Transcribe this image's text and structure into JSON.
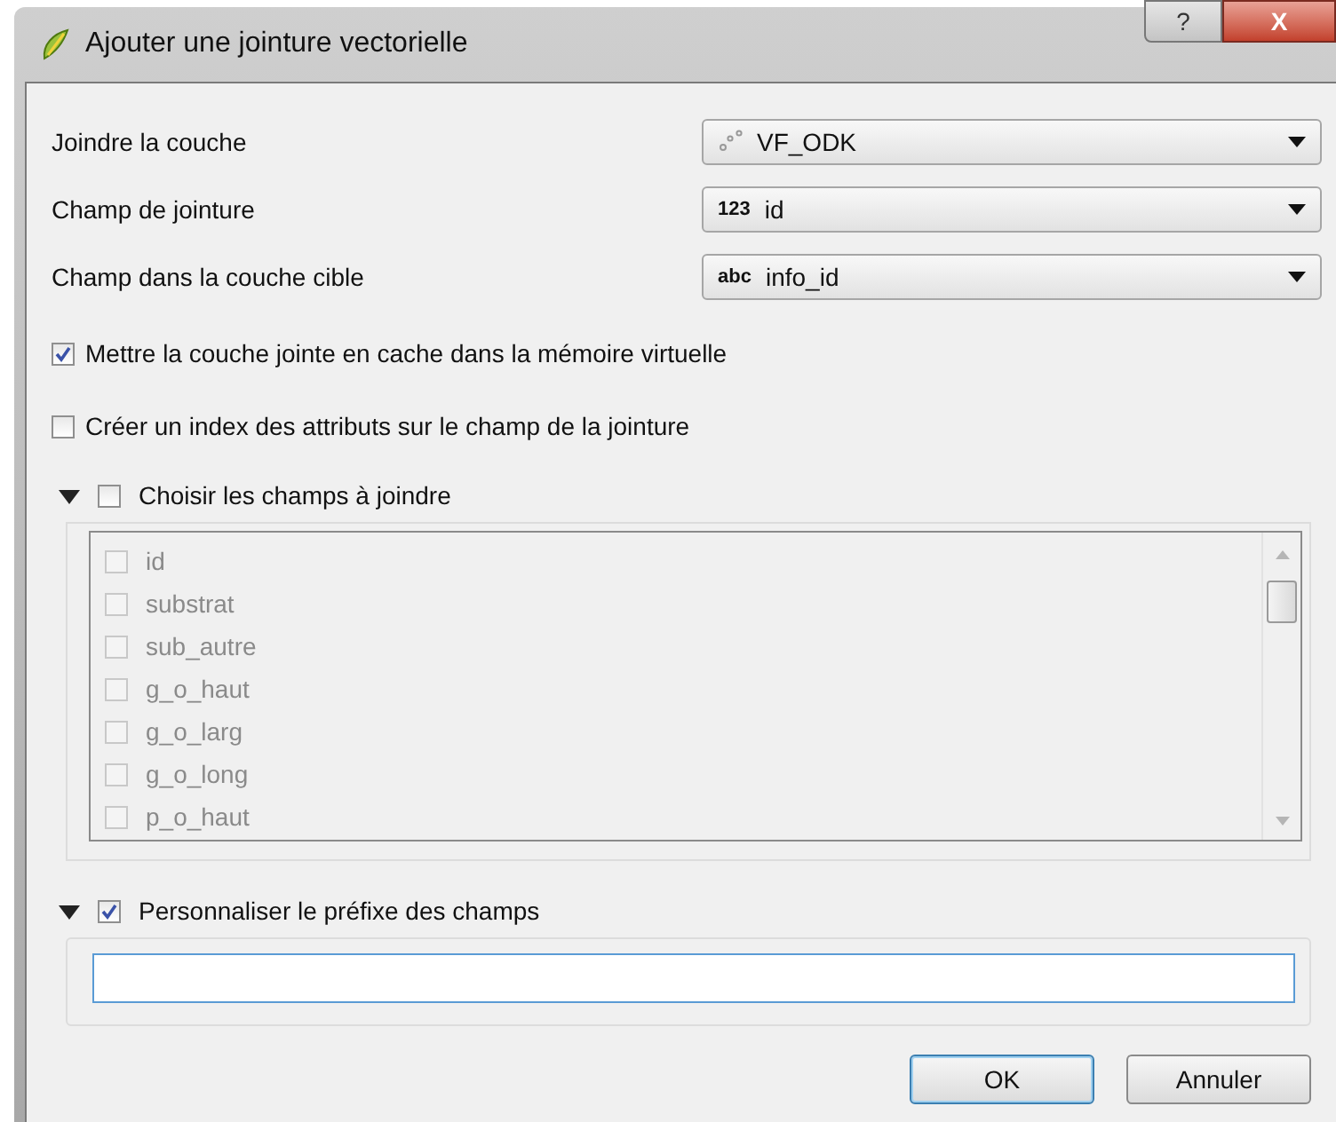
{
  "window": {
    "title": "Ajouter une jointure vectorielle",
    "help_button": "?",
    "close_button": "X"
  },
  "fields": [
    {
      "label": "Joindre la couche",
      "value": "VF_ODK",
      "kind": "layer"
    },
    {
      "label": "Champ de jointure",
      "value": "id",
      "kind": "field",
      "type_label": "123"
    },
    {
      "label": "Champ dans la couche cible",
      "value": "info_id",
      "kind": "field",
      "type_label": "abc"
    }
  ],
  "options": [
    {
      "label": "Mettre la couche jointe en cache dans la mémoire virtuelle",
      "checked": true
    },
    {
      "label": "Créer un index des attributs sur le champ de la jointure",
      "checked": false
    }
  ],
  "choose_fields": {
    "title": "Choisir les champs à joindre",
    "expanded": true,
    "checked": false,
    "items": [
      {
        "label": "id",
        "checked": false
      },
      {
        "label": "substrat",
        "checked": false
      },
      {
        "label": "sub_autre",
        "checked": false
      },
      {
        "label": "g_o_haut",
        "checked": false
      },
      {
        "label": "g_o_larg",
        "checked": false
      },
      {
        "label": "g_o_long",
        "checked": false
      },
      {
        "label": "p_o_haut",
        "checked": false
      }
    ]
  },
  "prefix": {
    "title": "Personnaliser le préfixe des champs",
    "expanded": true,
    "checked": true
  },
  "buttons": [
    {
      "label": "OK",
      "default": true
    },
    {
      "label": "Annuler",
      "default": false
    }
  ]
}
